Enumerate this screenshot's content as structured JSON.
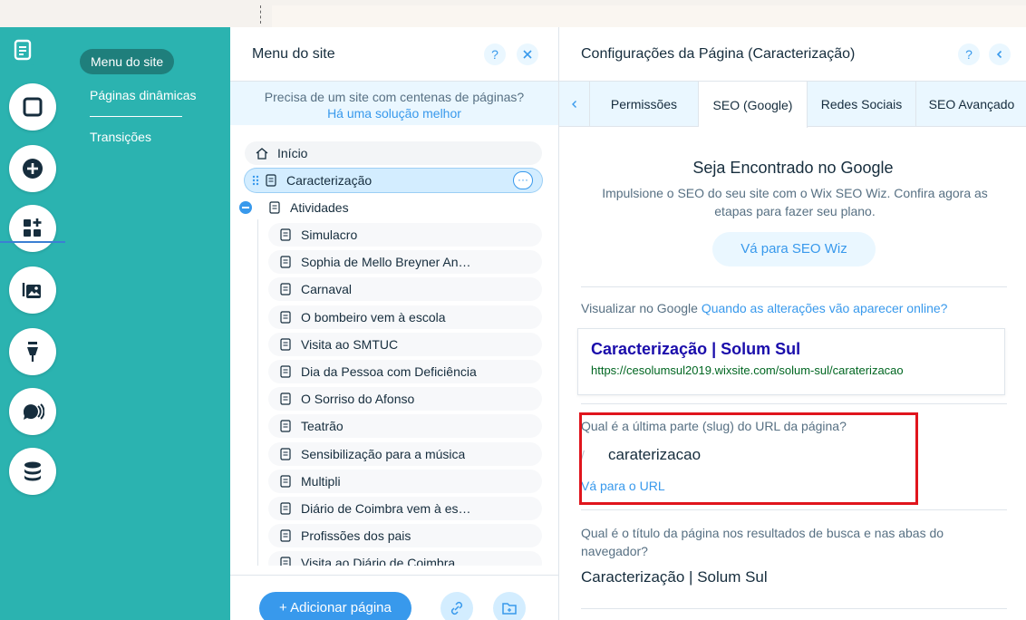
{
  "site_nav": {
    "active": "Menu do site",
    "items": [
      "Páginas dinâmicas",
      "Transições"
    ]
  },
  "pages_panel": {
    "title": "Menu do site",
    "help": "?",
    "banner_text": "Precisa de um site com centenas de páginas?",
    "banner_link": "Há uma solução melhor",
    "pages": [
      {
        "label": "Início",
        "level": 0,
        "icon": "home-icon"
      },
      {
        "label": "Caracterização",
        "level": 0,
        "selected": true,
        "icon": "page-icon",
        "more": "···"
      },
      {
        "label": "Atividades",
        "level": 0,
        "icon": "page-icon",
        "expanded": true
      },
      {
        "label": "Simulacro",
        "level": 1,
        "icon": "page-icon"
      },
      {
        "label": "Sophia de Mello Breyner An…",
        "level": 1,
        "icon": "page-icon"
      },
      {
        "label": "Carnaval",
        "level": 1,
        "icon": "page-icon"
      },
      {
        "label": "O bombeiro vem à escola",
        "level": 1,
        "icon": "page-icon"
      },
      {
        "label": "Visita ao SMTUC",
        "level": 1,
        "icon": "page-icon"
      },
      {
        "label": "Dia da Pessoa com Deficiência",
        "level": 1,
        "icon": "page-icon"
      },
      {
        "label": "O Sorriso do Afonso",
        "level": 1,
        "icon": "page-icon"
      },
      {
        "label": "Teatrão",
        "level": 1,
        "icon": "page-icon"
      },
      {
        "label": "Sensibilização para a música",
        "level": 1,
        "icon": "page-icon"
      },
      {
        "label": "Multipli",
        "level": 1,
        "icon": "page-icon"
      },
      {
        "label": "Diário de Coimbra vem à es…",
        "level": 1,
        "icon": "page-icon"
      },
      {
        "label": "Profissões dos pais",
        "level": 1,
        "icon": "page-icon"
      },
      {
        "label": "Visita ao Diário de Coimbra",
        "level": 1,
        "icon": "page-icon"
      }
    ],
    "add_page_label": "+ Adicionar página"
  },
  "settings_panel": {
    "title": "Configurações da Página (Caracterização)",
    "help": "?",
    "tabs": [
      "Permissões",
      "SEO (Google)",
      "Redes Sociais",
      "SEO Avançado"
    ],
    "active_tab": "SEO (Google)",
    "seo_heading": "Seja Encontrado no Google",
    "seo_text": "Impulsione o SEO do seu site com o Wix SEO Wiz. Confira agora as etapas para fazer seu plano.",
    "seo_button": "Vá para SEO Wiz",
    "preview_label": "Visualizar no Google",
    "preview_link": "Quando as alterações vão aparecer online?",
    "google_title": "Caracterização | Solum Sul",
    "google_url": "https://cesolumsul2019.wixsite.com/solum-sul/caraterizacao",
    "slug_label": "Qual é a última parte (slug) do URL da página?",
    "slug_prefix": "/",
    "slug_value": "caraterizacao",
    "slug_link": "Vá para o URL",
    "page_title_label": "Qual é o título da página nos resultados de busca e nas abas do navegador?",
    "page_title_value": "Caracterização |  Solum Sul"
  },
  "colors": {
    "teal": "#2bb3b0",
    "accent_blue": "#3899ec",
    "highlight_red": "#e0151d"
  }
}
